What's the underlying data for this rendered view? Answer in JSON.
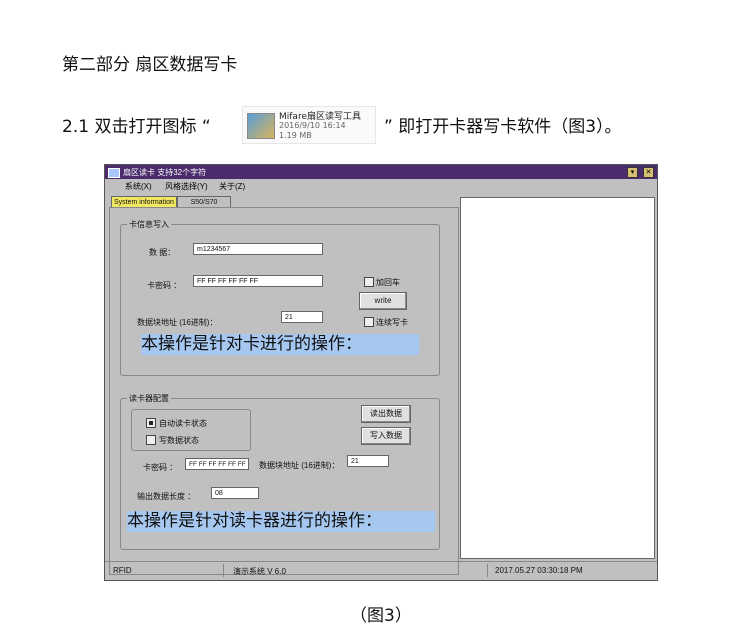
{
  "doc": {
    "section_title": "第二部分 扇区数据写卡",
    "step_text_before": "2.1 双击打开图标 “",
    "step_text_after": "” 即打开卡器写卡软件（图3）。",
    "figure_caption": "（图3）"
  },
  "file_icon": {
    "name": "Mifare扇区读写工具",
    "date": "2016/9/10 16:14",
    "size": "1.19 MB"
  },
  "app": {
    "title": "扇区读卡 支持32个字符",
    "menu": [
      "系统(X)",
      "风格选择(Y)",
      "关于(Z)"
    ],
    "tabs": [
      "System information",
      "S50/S70"
    ],
    "write_group": {
      "title": "卡信息写入",
      "data_label": "数 据：",
      "data_value": "m1234567",
      "key_label": "卡密码 ：",
      "key_value": "FF FF FF FF FF FF",
      "block_label": "数据块地址 (16进制)：",
      "block_value": "21",
      "enter_label": "加回车",
      "write_button": "write",
      "continuous_label": "连续写卡",
      "note": "本操作是针对卡进行的操作："
    },
    "reader_group": {
      "title": "读卡器配置",
      "auto_read_label": "自动读卡状态",
      "write_data_label": "写数据状态",
      "read_button": "读出数据",
      "write_button": "写入数据",
      "key_label": "卡密码 ：",
      "key_value": "FF FF FF FF FF FF",
      "block_label": "数据块地址 (16进制)：",
      "block_value": "21",
      "length_label": "输出数据长度 ：",
      "length_value": "08",
      "note": "本操作是针对读卡器进行的操作："
    },
    "status": {
      "left": "RFID",
      "middle": "演示系统  V 6.0",
      "right": "2017.05.27   03:30:18 PM"
    }
  }
}
